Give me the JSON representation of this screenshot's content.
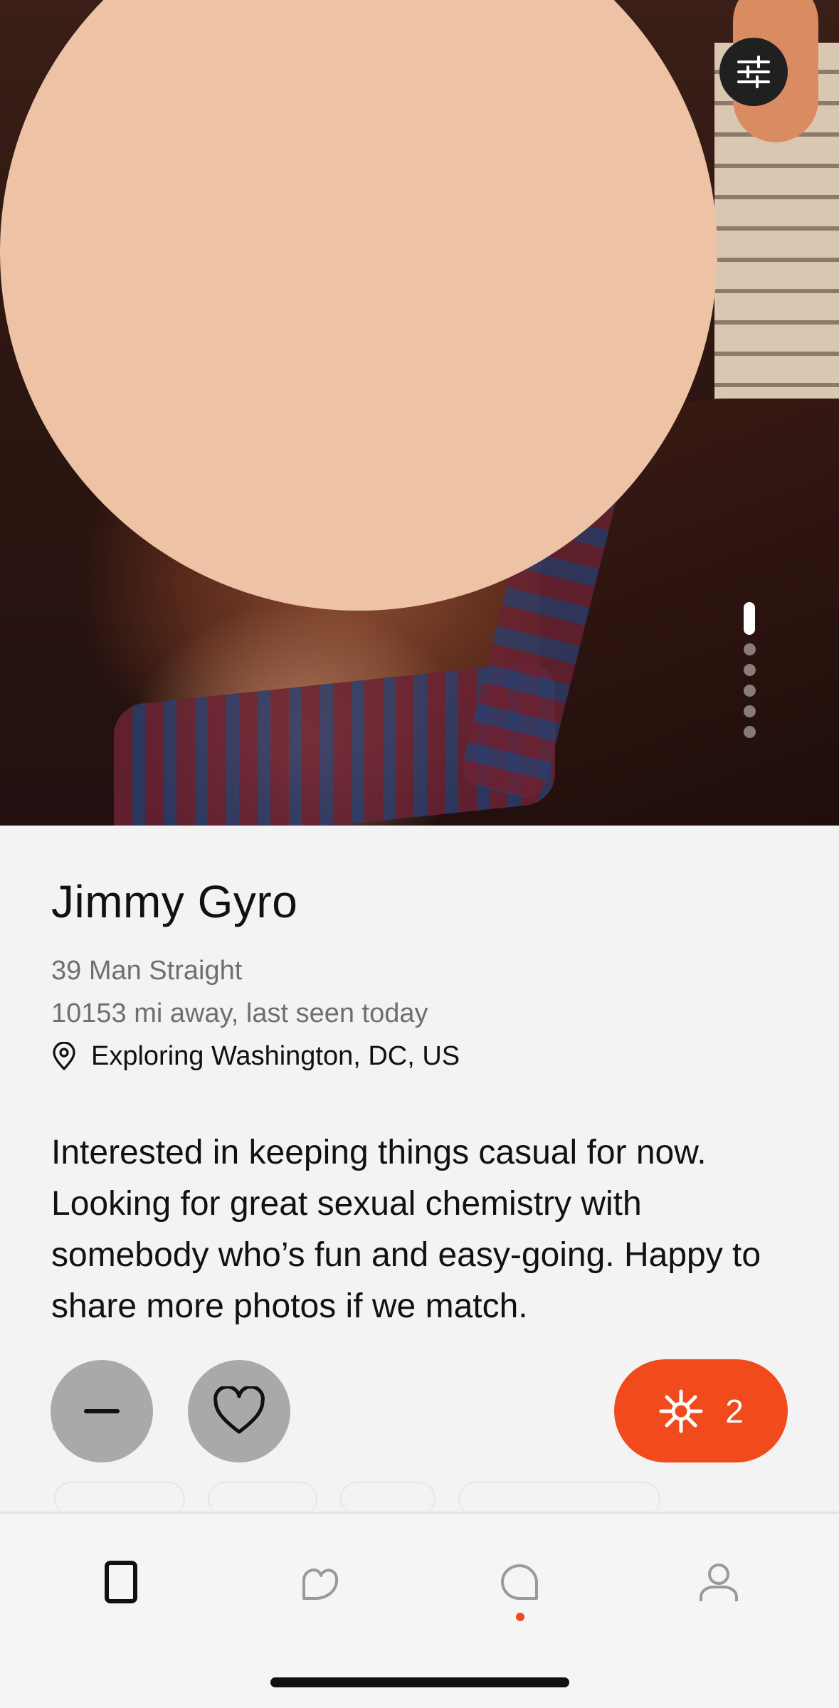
{
  "profile": {
    "name": "Jimmy Gyro",
    "details": "39 Man Straight",
    "distance": "10153 mi away, last seen today",
    "location": "Exploring Washington, DC, US",
    "bio": "Interested in keeping things casual for now. Looking for great sexual chemistry with somebody who’s fun and easy-going. Happy to share more photos if we match.",
    "photo_count": 6,
    "current_photo": 1
  },
  "actions": {
    "spark_count": "2"
  },
  "section_label_partial": "s",
  "icons": {
    "filter": "sliders-icon",
    "pass": "minus-icon",
    "like": "heart-icon",
    "spark": "spark-icon",
    "discover": "card-icon",
    "likes": "blob-heart-icon",
    "chats": "chat-bubble-icon",
    "profile": "person-icon"
  },
  "colors": {
    "accent": "#f04a1d",
    "button_gray": "#a9a9a9",
    "background": "#f3f3f3"
  }
}
